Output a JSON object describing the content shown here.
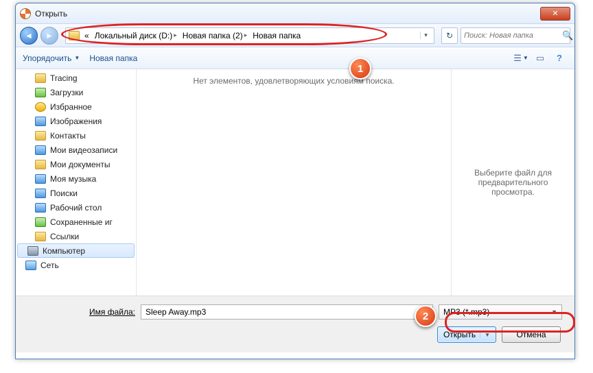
{
  "titlebar": {
    "title": "Открыть"
  },
  "breadcrumb": {
    "prefix": "«",
    "items": [
      "Локальный диск (D:)",
      "Новая папка (2)",
      "Новая папка"
    ]
  },
  "search": {
    "placeholder": "Поиск: Новая папка"
  },
  "toolbar": {
    "organize": "Упорядочить",
    "new_folder": "Новая папка"
  },
  "sidebar": {
    "items": [
      {
        "label": "Tracing",
        "icon": "folder"
      },
      {
        "label": "Загрузки",
        "icon": "green"
      },
      {
        "label": "Избранное",
        "icon": "star"
      },
      {
        "label": "Изображения",
        "icon": "blue"
      },
      {
        "label": "Контакты",
        "icon": "folder"
      },
      {
        "label": "Мои видеозаписи",
        "icon": "blue"
      },
      {
        "label": "Мои документы",
        "icon": "folder"
      },
      {
        "label": "Моя музыка",
        "icon": "blue"
      },
      {
        "label": "Поиски",
        "icon": "blue"
      },
      {
        "label": "Рабочий стол",
        "icon": "blue"
      },
      {
        "label": "Сохраненные иг",
        "icon": "green"
      },
      {
        "label": "Ссылки",
        "icon": "folder"
      }
    ],
    "computer": "Компьютер",
    "network": "Сеть"
  },
  "content": {
    "empty": "Нет элементов, удовлетворяющих условиям поиска."
  },
  "preview": {
    "text": "Выберите файл для предварительного просмотра."
  },
  "bottom": {
    "filename_label_u": "И",
    "filename_label_rest": "мя файла:",
    "filename_value": "Sleep Away.mp3",
    "filter": "MP3 (*.mp3)",
    "open": "Открыть",
    "cancel": "Отмена"
  },
  "badges": {
    "one": "1",
    "two": "2"
  }
}
